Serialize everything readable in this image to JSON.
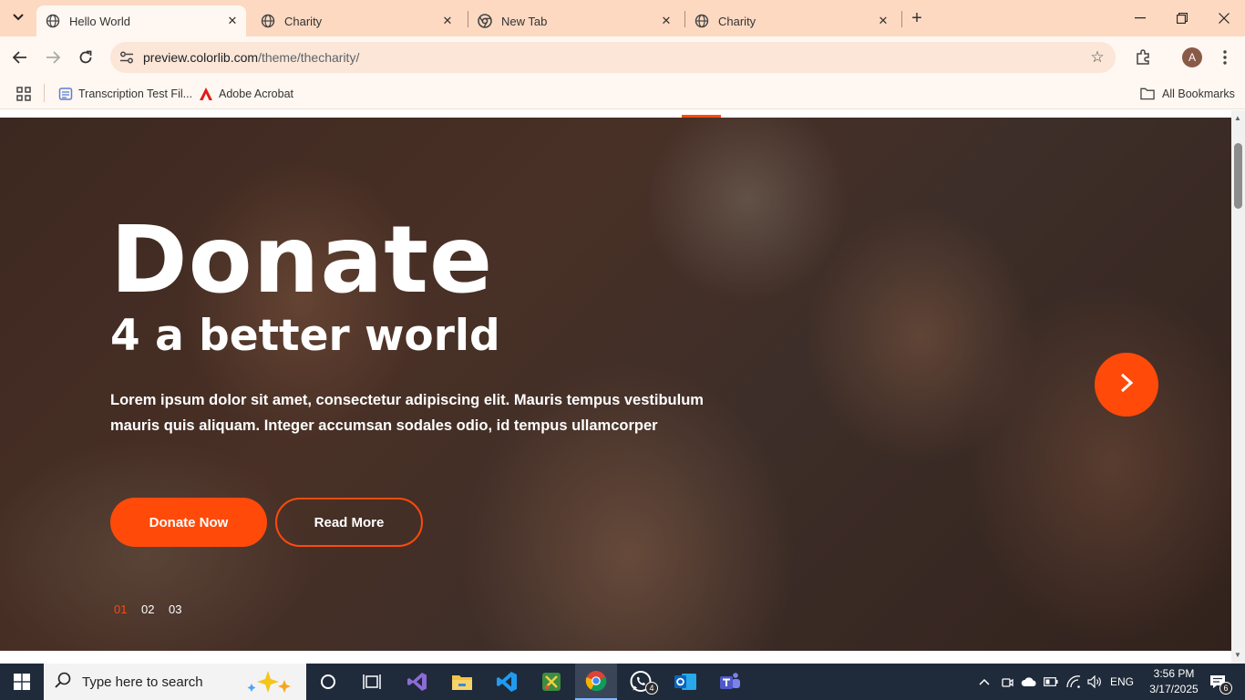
{
  "tabs": [
    {
      "title": "Hello World",
      "active": true
    },
    {
      "title": "Charity",
      "active": false
    },
    {
      "title": "New Tab",
      "active": false
    },
    {
      "title": "Charity",
      "active": false
    }
  ],
  "address_bar": {
    "host": "preview.colorlib.com",
    "path": "/theme/thecharity/"
  },
  "profile_initial": "A",
  "bookmarks": [
    {
      "label": "Transcription Test Fil...",
      "icon": "doc-icon"
    },
    {
      "label": "Adobe Acrobat",
      "icon": "acrobat-icon"
    }
  ],
  "all_bookmarks": "All Bookmarks",
  "hero": {
    "title": "Donate",
    "subtitle": "4 a better world",
    "text": "Lorem ipsum dolor sit amet, consectetur adipiscing elit. Mauris tempus vestibulum mauris quis aliquam. Integer accumsan sodales odio, id tempus ullamcorper",
    "primary_button": "Donate Now",
    "secondary_button": "Read More",
    "pager": [
      "01",
      "02",
      "03"
    ],
    "active_slide": "01"
  },
  "colors": {
    "accent": "#ff4a0a",
    "tab_strip": "#fdd9c2",
    "taskbar": "#1f2a3a"
  },
  "taskbar": {
    "search_placeholder": "Type here to search",
    "whatsapp_badge": "4",
    "language": "ENG",
    "time": "3:56 PM",
    "date": "3/17/2025",
    "notifications": "6"
  }
}
